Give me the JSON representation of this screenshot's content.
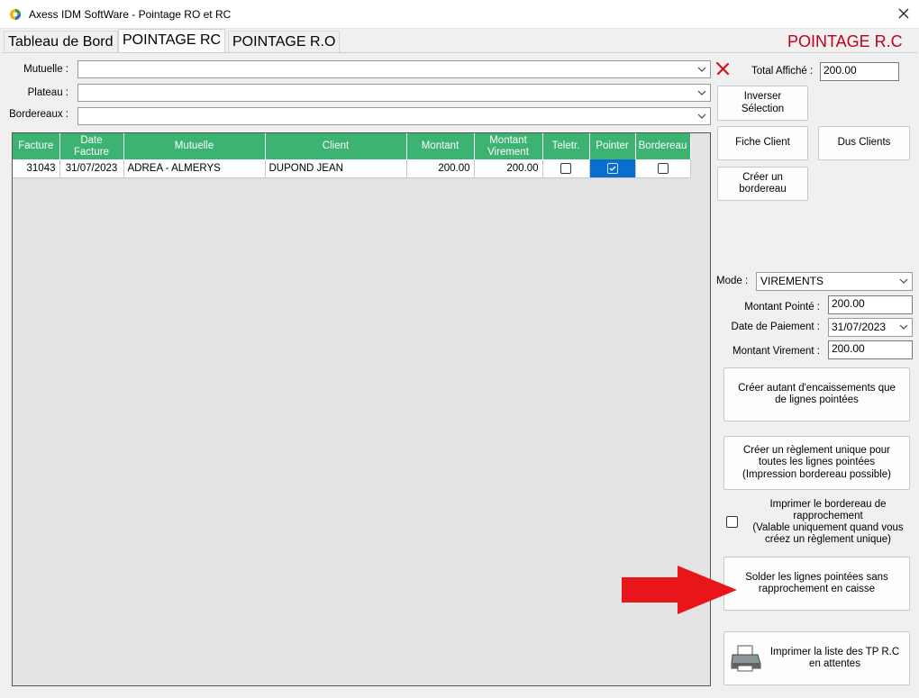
{
  "window": {
    "title": "Axess IDM SoftWare - Pointage RO et RC"
  },
  "tabs": [
    {
      "label": "Tableau de Bord"
    },
    {
      "label": "POINTAGE RC"
    },
    {
      "label": "POINTAGE R.O"
    }
  ],
  "page_heading": "POINTAGE R.C",
  "filters": {
    "mutuelle_label": "Mutuelle :",
    "plateau_label": "Plateau :",
    "bordereaux_label": "Bordereaux :",
    "mutuelle_value": "",
    "plateau_value": "",
    "bordereaux_value": ""
  },
  "total": {
    "label": "Total Affiché :",
    "value": "200.00"
  },
  "buttons": {
    "inverser": "Inverser Sélection",
    "fiche_client": "Fiche Client",
    "dus_clients": "Dus Clients",
    "creer_bordereau": "Créer un bordereau",
    "creer_encaissements": "Créer autant d'encaissements que de lignes pointées",
    "creer_reglement": "Créer un règlement unique pour toutes les lignes pointées\n(Impression bordereau possible)",
    "solder": "Solder les lignes pointées sans rapprochement en caisse",
    "imprimer_liste": "Imprimer la liste des TP R.C en attentes"
  },
  "payment": {
    "mode_label": "Mode :",
    "mode_value": "VIREMENTS",
    "montant_pointe_label": "Montant Pointé :",
    "montant_pointe_value": "200.00",
    "date_paiement_label": "Date de Paiement :",
    "date_paiement_value": "31/07/2023",
    "montant_virement_label": "Montant Virement :",
    "montant_virement_value": "200.00"
  },
  "print_option": {
    "label": "Imprimer le bordereau de rapprochement\n(Valable uniquement quand vous créez un règlement unique)",
    "checked": false
  },
  "table": {
    "columns": [
      "Facture",
      "Date Facture",
      "Mutuelle",
      "Client",
      "Montant",
      "Montant Virement",
      "Teletr.",
      "Pointer",
      "Bordereau"
    ],
    "rows": [
      {
        "facture": "31043",
        "date_facture": "31/07/2023",
        "mutuelle": "ADREA - ALMERYS",
        "client": "DUPOND JEAN",
        "montant": "200.00",
        "montant_virement": "200.00",
        "teletr": false,
        "pointer": true,
        "bordereau": false
      }
    ]
  },
  "colors": {
    "header_green": "#3cb371",
    "title_red": "#c0001b",
    "select_blue": "#0a6ed1",
    "arrow_red": "#e8151b"
  },
  "icons": {
    "app": "app-logo-icon",
    "close": "close-icon",
    "clear": "clear-x-icon",
    "caret": "chevron-down-icon",
    "printer": "printer-icon",
    "arrow": "red-arrow-icon"
  }
}
